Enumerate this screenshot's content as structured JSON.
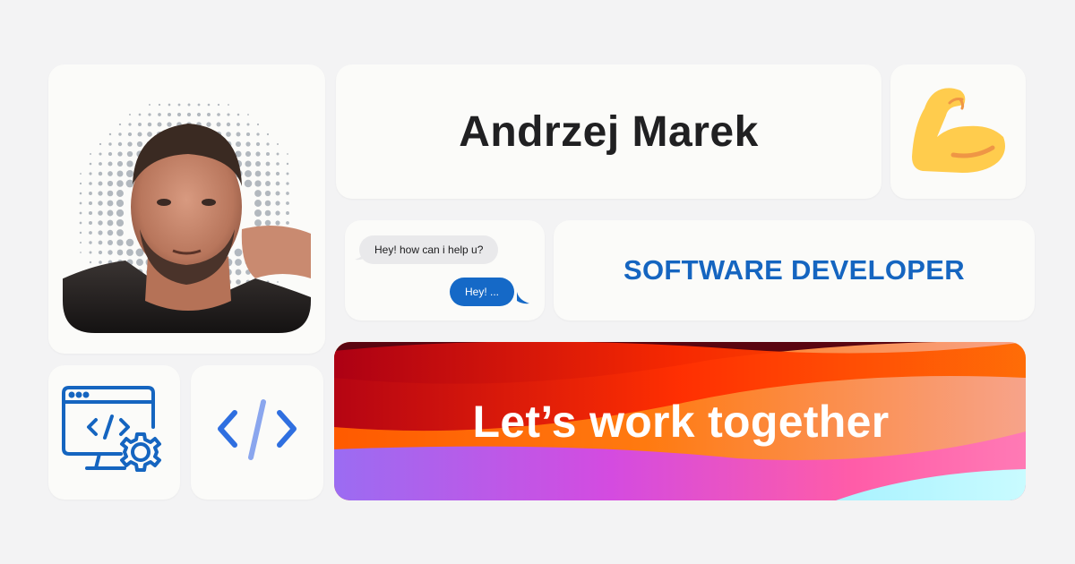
{
  "profile": {
    "name": "Andrzej Marek",
    "role": "SOFTWARE DEVELOPER",
    "photo_alt": "Profile photo"
  },
  "chat": {
    "incoming": "Hey! how can i help u?",
    "outgoing": "Hey! ..."
  },
  "cta": {
    "text": "Let’s work together"
  },
  "icons": {
    "flex": "flexed-biceps-icon",
    "developer": "monitor-code-gear-icon",
    "code": "code-brackets-icon"
  },
  "colors": {
    "background": "#f3f3f4",
    "card": "#fbfbf9",
    "accent_blue": "#1565c0",
    "chat_blue": "#1569c7",
    "chat_grey": "#e9e9eb",
    "name_text": "#202022"
  }
}
